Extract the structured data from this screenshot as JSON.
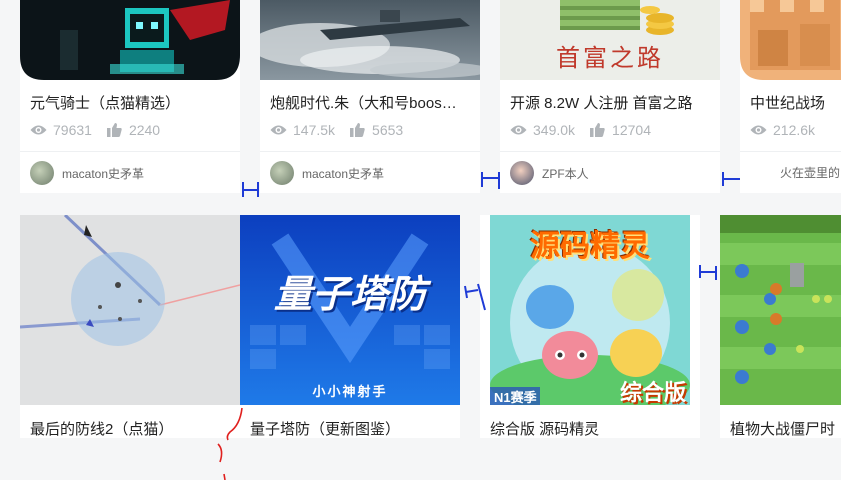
{
  "row1": [
    {
      "title": "元气骑士（点猫精选）",
      "views": "79631",
      "likes": "2240",
      "author": "macaton史矛革"
    },
    {
      "title": "炮舰时代.朱（大和号boos…",
      "views": "147.5k",
      "likes": "5653",
      "author": "macaton史矛革"
    },
    {
      "title": "开源 8.2W 人注册 首富之路",
      "views": "349.0k",
      "likes": "12704",
      "author": "ZPF本人",
      "thumb_text": "首富之路"
    },
    {
      "title": "中世纪战场",
      "views": "212.6k",
      "likes": "",
      "author": "火在壶里的"
    }
  ],
  "row2": [
    {
      "title": "最后的防线2（点猫）"
    },
    {
      "title": "量子塔防（更新图鉴）",
      "thumb_title": "量子塔防",
      "thumb_sub": "小小神射手"
    },
    {
      "title": "综合版 源码精灵",
      "thumb_title": "源码精灵",
      "thumb_sub": "综合版",
      "thumb_corner": "N1赛季"
    },
    {
      "title": "植物大战僵尸时"
    }
  ],
  "colors": {
    "annotation_blue": "#1f3bd6",
    "annotation_red": "#e0201e",
    "stat_gray": "#b0b4b8"
  },
  "icons": {
    "views": "eye-icon",
    "likes": "thumbs-up-icon"
  }
}
